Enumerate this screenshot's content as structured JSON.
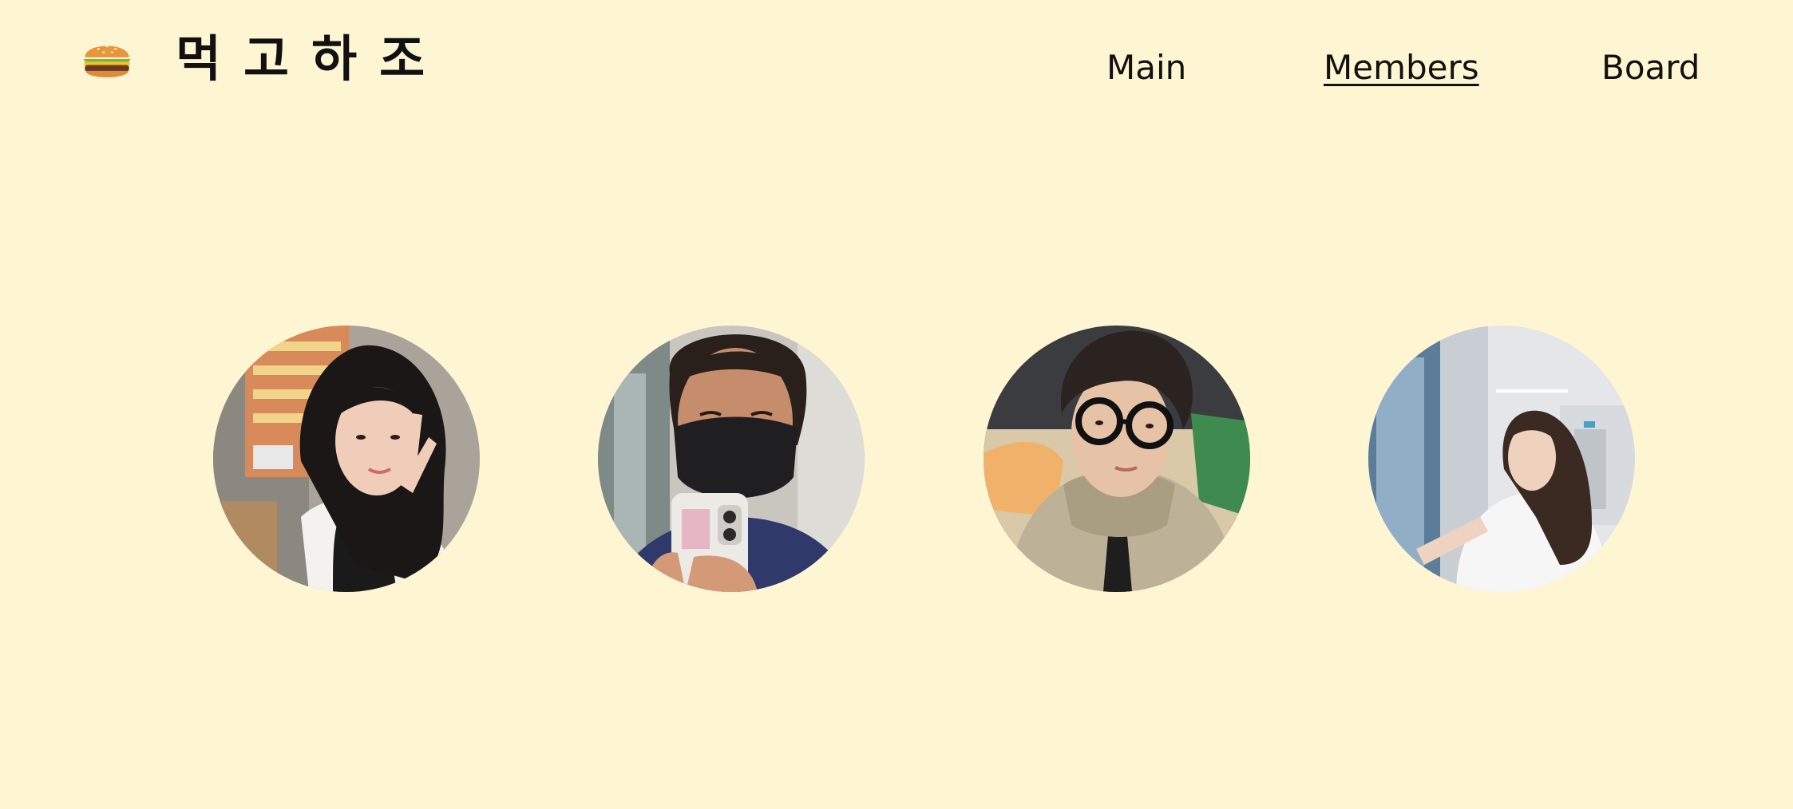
{
  "brand": {
    "icon": "hamburger-icon",
    "title": "먹고하조"
  },
  "nav": {
    "items": [
      {
        "label": "Main",
        "active": false
      },
      {
        "label": "Members",
        "active": true
      },
      {
        "label": "Board",
        "active": false
      }
    ]
  },
  "members": [
    {
      "photo": "member-photo-1",
      "description_icon": "person-photo"
    },
    {
      "photo": "member-photo-2",
      "description_icon": "person-photo"
    },
    {
      "photo": "member-photo-3",
      "description_icon": "person-photo"
    },
    {
      "photo": "member-photo-4",
      "description_icon": "person-photo"
    }
  ],
  "colors": {
    "background": "#fef6d3",
    "text": "#111111"
  }
}
